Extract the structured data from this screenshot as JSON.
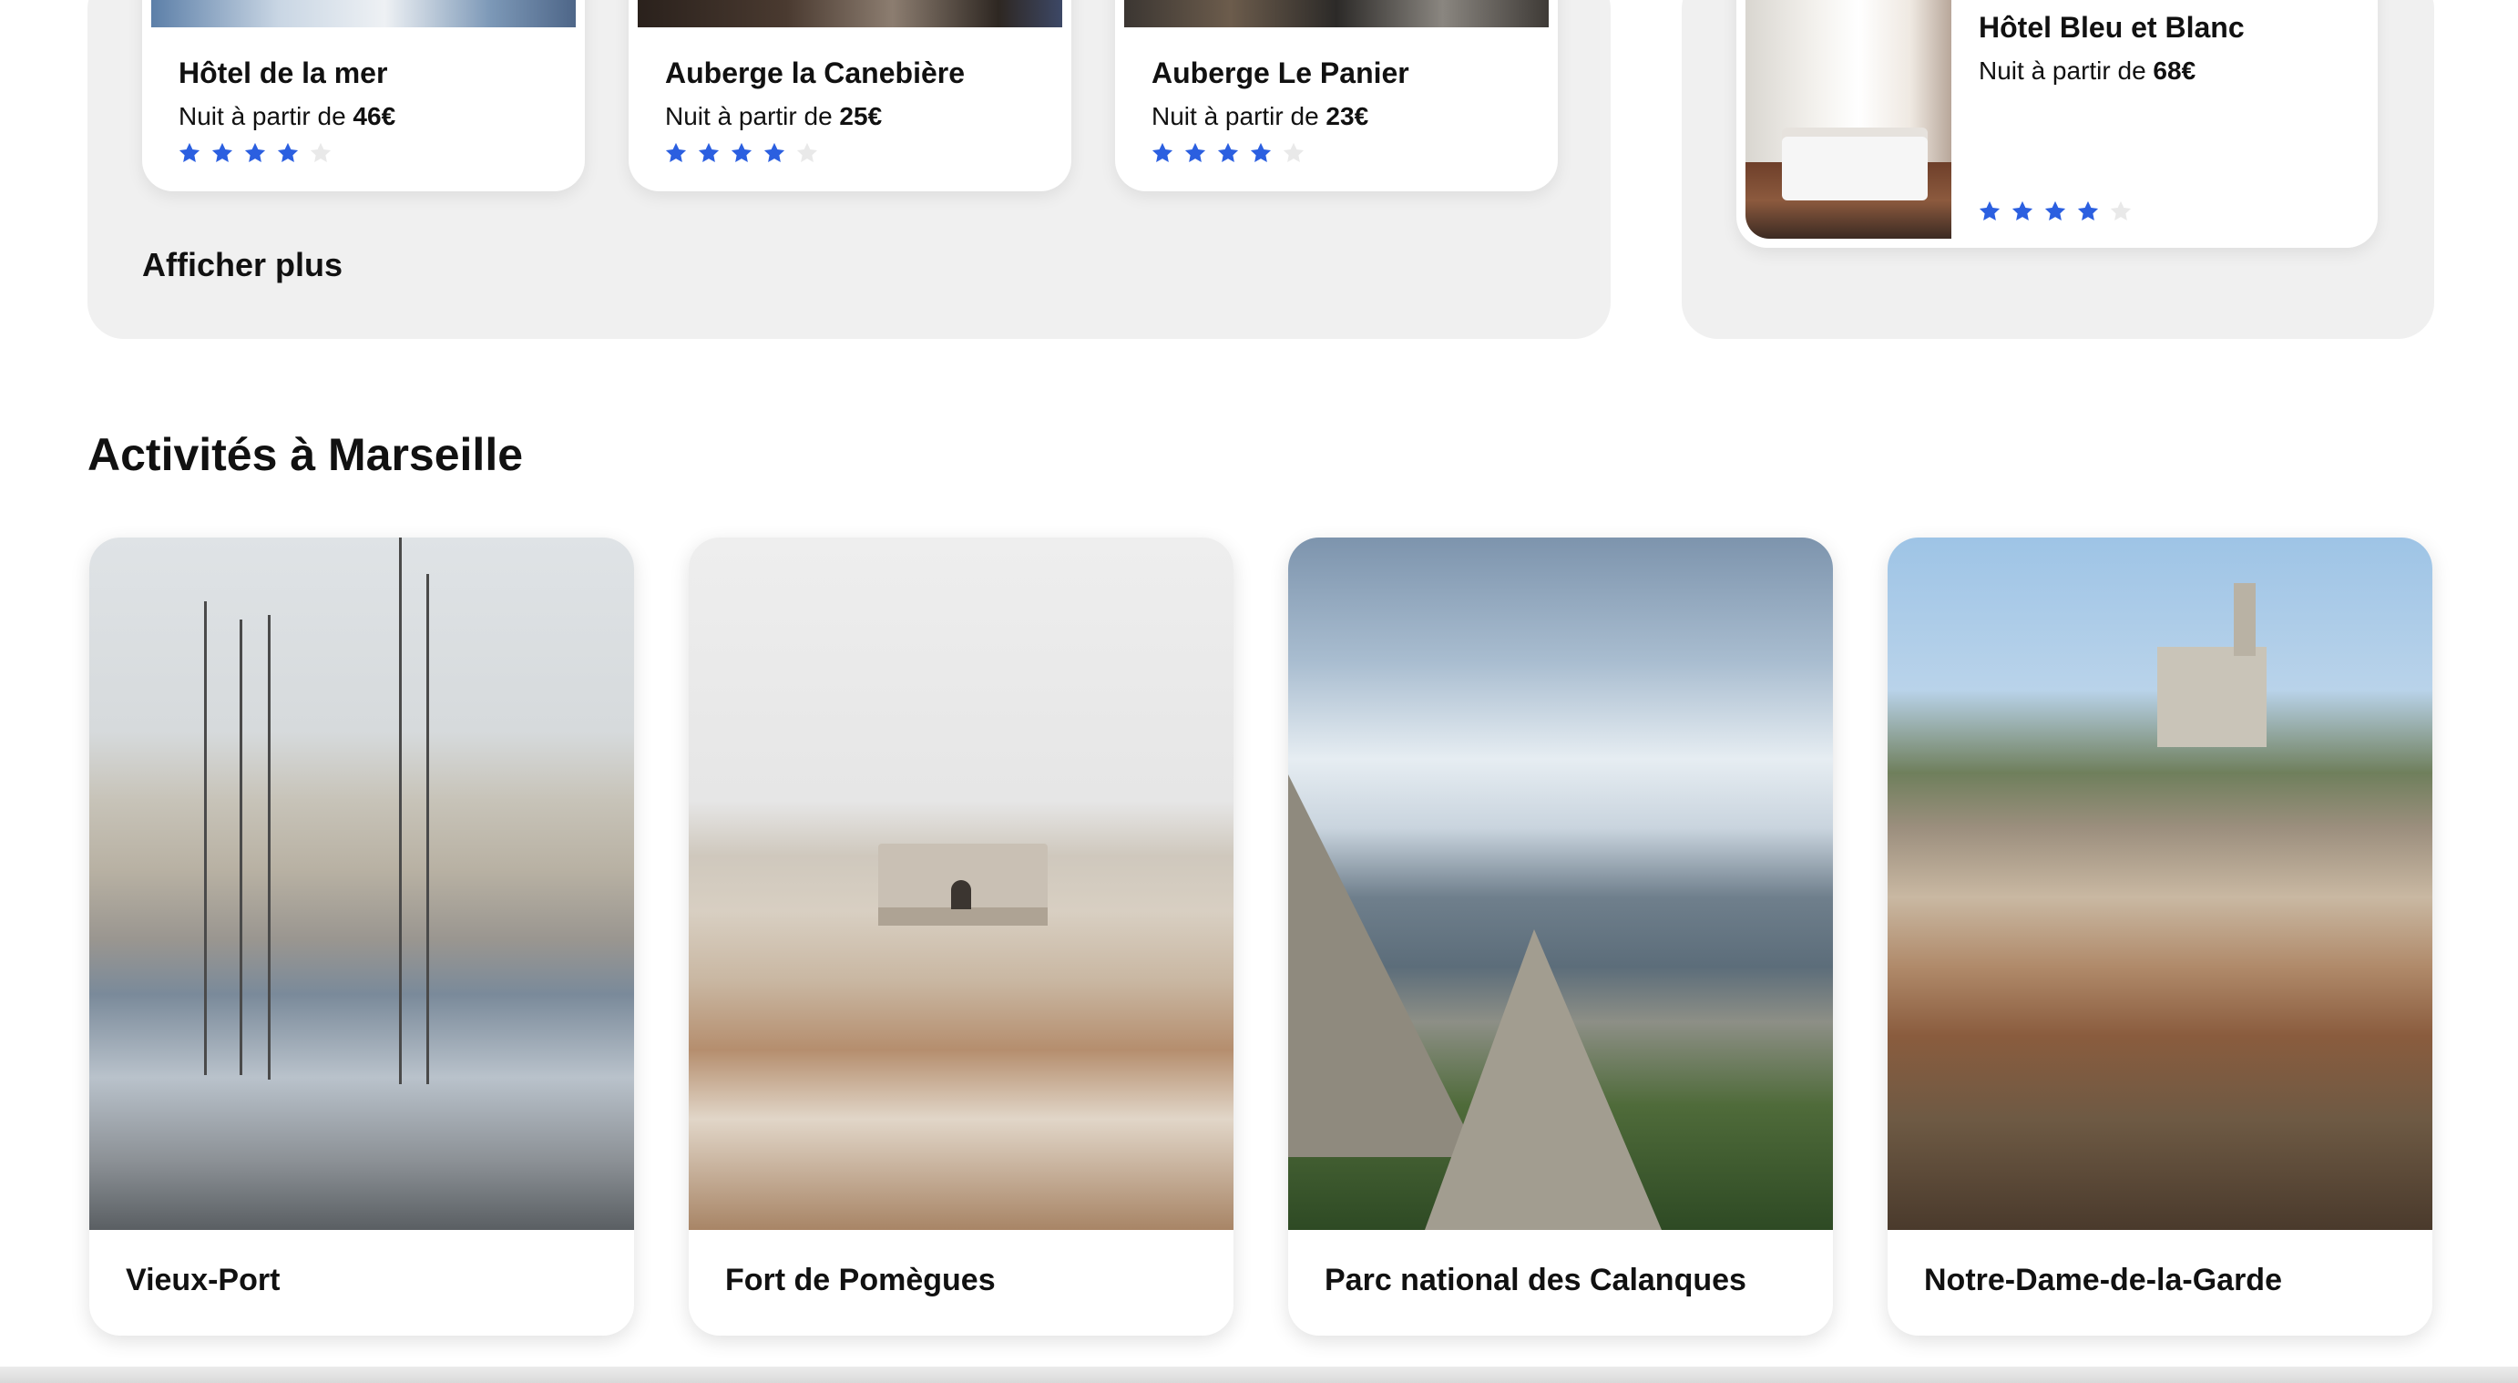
{
  "hotels_top": [
    {
      "name": "Hôtel de la mer",
      "price_prefix": "Nuit à partir de ",
      "price": "46€",
      "rating": 4,
      "max_rating": 5
    },
    {
      "name": "Auberge la Canebière",
      "price_prefix": "Nuit à partir de ",
      "price": "25€",
      "rating": 4,
      "max_rating": 5
    },
    {
      "name": "Auberge Le Panier",
      "price_prefix": "Nuit à partir de ",
      "price": "23€",
      "rating": 4,
      "max_rating": 5
    }
  ],
  "hotel_side": {
    "name": "Hôtel Bleu et Blanc",
    "price_prefix": "Nuit à partir de ",
    "price": "68€",
    "rating": 4,
    "max_rating": 5
  },
  "show_more_label": "Afficher plus",
  "activities_title": "Activités à Marseille",
  "activities": [
    {
      "label": "Vieux-Port"
    },
    {
      "label": "Fort de Pomègues"
    },
    {
      "label": "Parc national des Calanques"
    },
    {
      "label": "Notre-Dame-de-la-Garde"
    }
  ],
  "colors": {
    "star_filled": "#2b5fe0",
    "star_empty": "#e9e9e9",
    "panel_bg": "#f0f0f0"
  },
  "icons": {
    "star": "star-icon"
  }
}
